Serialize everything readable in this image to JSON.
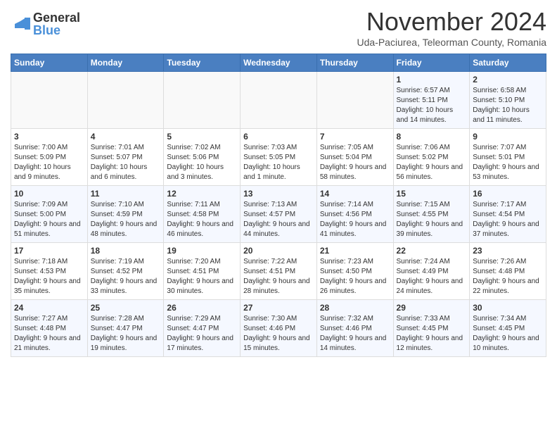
{
  "header": {
    "logo_general": "General",
    "logo_blue": "Blue",
    "month_title": "November 2024",
    "subtitle": "Uda-Paciurea, Teleorman County, Romania"
  },
  "columns": [
    "Sunday",
    "Monday",
    "Tuesday",
    "Wednesday",
    "Thursday",
    "Friday",
    "Saturday"
  ],
  "weeks": [
    [
      {
        "day": "",
        "info": ""
      },
      {
        "day": "",
        "info": ""
      },
      {
        "day": "",
        "info": ""
      },
      {
        "day": "",
        "info": ""
      },
      {
        "day": "",
        "info": ""
      },
      {
        "day": "1",
        "info": "Sunrise: 6:57 AM\nSunset: 5:11 PM\nDaylight: 10 hours and 14 minutes."
      },
      {
        "day": "2",
        "info": "Sunrise: 6:58 AM\nSunset: 5:10 PM\nDaylight: 10 hours and 11 minutes."
      }
    ],
    [
      {
        "day": "3",
        "info": "Sunrise: 7:00 AM\nSunset: 5:09 PM\nDaylight: 10 hours and 9 minutes."
      },
      {
        "day": "4",
        "info": "Sunrise: 7:01 AM\nSunset: 5:07 PM\nDaylight: 10 hours and 6 minutes."
      },
      {
        "day": "5",
        "info": "Sunrise: 7:02 AM\nSunset: 5:06 PM\nDaylight: 10 hours and 3 minutes."
      },
      {
        "day": "6",
        "info": "Sunrise: 7:03 AM\nSunset: 5:05 PM\nDaylight: 10 hours and 1 minute."
      },
      {
        "day": "7",
        "info": "Sunrise: 7:05 AM\nSunset: 5:04 PM\nDaylight: 9 hours and 58 minutes."
      },
      {
        "day": "8",
        "info": "Sunrise: 7:06 AM\nSunset: 5:02 PM\nDaylight: 9 hours and 56 minutes."
      },
      {
        "day": "9",
        "info": "Sunrise: 7:07 AM\nSunset: 5:01 PM\nDaylight: 9 hours and 53 minutes."
      }
    ],
    [
      {
        "day": "10",
        "info": "Sunrise: 7:09 AM\nSunset: 5:00 PM\nDaylight: 9 hours and 51 minutes."
      },
      {
        "day": "11",
        "info": "Sunrise: 7:10 AM\nSunset: 4:59 PM\nDaylight: 9 hours and 48 minutes."
      },
      {
        "day": "12",
        "info": "Sunrise: 7:11 AM\nSunset: 4:58 PM\nDaylight: 9 hours and 46 minutes."
      },
      {
        "day": "13",
        "info": "Sunrise: 7:13 AM\nSunset: 4:57 PM\nDaylight: 9 hours and 44 minutes."
      },
      {
        "day": "14",
        "info": "Sunrise: 7:14 AM\nSunset: 4:56 PM\nDaylight: 9 hours and 41 minutes."
      },
      {
        "day": "15",
        "info": "Sunrise: 7:15 AM\nSunset: 4:55 PM\nDaylight: 9 hours and 39 minutes."
      },
      {
        "day": "16",
        "info": "Sunrise: 7:17 AM\nSunset: 4:54 PM\nDaylight: 9 hours and 37 minutes."
      }
    ],
    [
      {
        "day": "17",
        "info": "Sunrise: 7:18 AM\nSunset: 4:53 PM\nDaylight: 9 hours and 35 minutes."
      },
      {
        "day": "18",
        "info": "Sunrise: 7:19 AM\nSunset: 4:52 PM\nDaylight: 9 hours and 33 minutes."
      },
      {
        "day": "19",
        "info": "Sunrise: 7:20 AM\nSunset: 4:51 PM\nDaylight: 9 hours and 30 minutes."
      },
      {
        "day": "20",
        "info": "Sunrise: 7:22 AM\nSunset: 4:51 PM\nDaylight: 9 hours and 28 minutes."
      },
      {
        "day": "21",
        "info": "Sunrise: 7:23 AM\nSunset: 4:50 PM\nDaylight: 9 hours and 26 minutes."
      },
      {
        "day": "22",
        "info": "Sunrise: 7:24 AM\nSunset: 4:49 PM\nDaylight: 9 hours and 24 minutes."
      },
      {
        "day": "23",
        "info": "Sunrise: 7:26 AM\nSunset: 4:48 PM\nDaylight: 9 hours and 22 minutes."
      }
    ],
    [
      {
        "day": "24",
        "info": "Sunrise: 7:27 AM\nSunset: 4:48 PM\nDaylight: 9 hours and 21 minutes."
      },
      {
        "day": "25",
        "info": "Sunrise: 7:28 AM\nSunset: 4:47 PM\nDaylight: 9 hours and 19 minutes."
      },
      {
        "day": "26",
        "info": "Sunrise: 7:29 AM\nSunset: 4:47 PM\nDaylight: 9 hours and 17 minutes."
      },
      {
        "day": "27",
        "info": "Sunrise: 7:30 AM\nSunset: 4:46 PM\nDaylight: 9 hours and 15 minutes."
      },
      {
        "day": "28",
        "info": "Sunrise: 7:32 AM\nSunset: 4:46 PM\nDaylight: 9 hours and 14 minutes."
      },
      {
        "day": "29",
        "info": "Sunrise: 7:33 AM\nSunset: 4:45 PM\nDaylight: 9 hours and 12 minutes."
      },
      {
        "day": "30",
        "info": "Sunrise: 7:34 AM\nSunset: 4:45 PM\nDaylight: 9 hours and 10 minutes."
      }
    ]
  ]
}
